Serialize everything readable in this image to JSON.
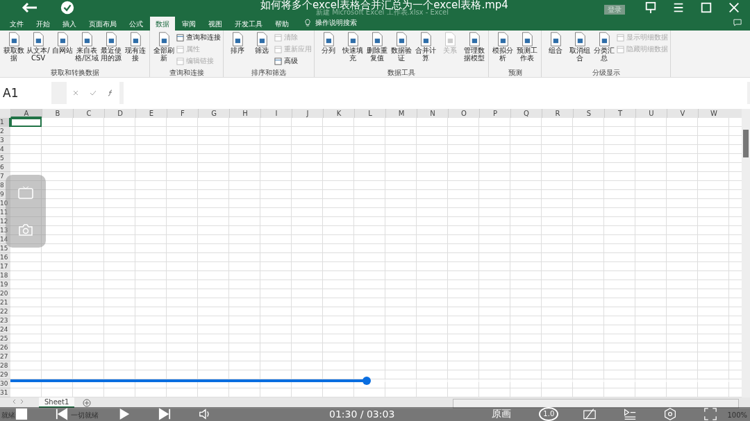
{
  "video": {
    "title": "如何将多个excel表格合并汇总为一个excel表格.mp4",
    "time": "01:30 / 03:03",
    "progress": {
      "level": 0.49
    },
    "quality": "原画",
    "speed": "1.0"
  },
  "excel": {
    "doc_title": "新建 Microsoft Excel 工作表.xlsx - Excel",
    "login": "登录",
    "tabs": [
      {
        "label": "文件",
        "selected": false
      },
      {
        "label": "开始",
        "selected": false
      },
      {
        "label": "插入",
        "selected": false
      },
      {
        "label": "页面布局",
        "selected": false
      },
      {
        "label": "公式",
        "selected": false
      },
      {
        "label": "数据",
        "selected": true
      },
      {
        "label": "审阅",
        "selected": false
      },
      {
        "label": "视图",
        "selected": false
      },
      {
        "label": "开发工具",
        "selected": false
      },
      {
        "label": "帮助",
        "selected": false
      }
    ],
    "tell_me": "操作说明搜索",
    "groups": [
      {
        "label": "获取和转换数据",
        "buttons": [
          {
            "label": "获取数据",
            "kind": "large",
            "disabled": false
          },
          {
            "label": "从文本/CSV",
            "kind": "large",
            "disabled": false
          },
          {
            "label": "自网站",
            "kind": "large",
            "disabled": false
          },
          {
            "label": "来自表格/区域",
            "kind": "large",
            "disabled": false
          },
          {
            "label": "最近使用的源",
            "kind": "large",
            "disabled": false
          },
          {
            "label": "现有连接",
            "kind": "large",
            "disabled": false
          }
        ]
      },
      {
        "label": "查询和连接",
        "buttons": [
          {
            "label": "全部刷新",
            "kind": "large",
            "disabled": false
          },
          {
            "label": "查询和连接",
            "kind": "small",
            "disabled": false
          },
          {
            "label": "属性",
            "kind": "small",
            "disabled": true
          },
          {
            "label": "编辑链接",
            "kind": "small",
            "disabled": true
          }
        ]
      },
      {
        "label": "排序和筛选",
        "buttons": [
          {
            "label": "排序",
            "kind": "large",
            "disabled": false
          },
          {
            "label": "筛选",
            "kind": "large",
            "disabled": false
          },
          {
            "label": "清除",
            "kind": "small",
            "disabled": true
          },
          {
            "label": "重新应用",
            "kind": "small",
            "disabled": true
          },
          {
            "label": "高级",
            "kind": "small",
            "disabled": false
          }
        ]
      },
      {
        "label": "数据工具",
        "buttons": [
          {
            "label": "分列",
            "kind": "large",
            "disabled": false
          },
          {
            "label": "快速填充",
            "kind": "large",
            "disabled": false
          },
          {
            "label": "删除重复值",
            "kind": "large",
            "disabled": false
          },
          {
            "label": "数据验证",
            "kind": "large",
            "disabled": false
          },
          {
            "label": "合并计算",
            "kind": "large",
            "disabled": false
          },
          {
            "label": "关系",
            "kind": "large",
            "disabled": true
          },
          {
            "label": "管理数据模型",
            "kind": "large",
            "disabled": false
          }
        ]
      },
      {
        "label": "预测",
        "buttons": [
          {
            "label": "模拟分析",
            "kind": "large",
            "disabled": false
          },
          {
            "label": "预测工作表",
            "kind": "large",
            "disabled": false
          }
        ]
      },
      {
        "label": "分级显示",
        "buttons": [
          {
            "label": "组合",
            "kind": "large",
            "disabled": false
          },
          {
            "label": "取消组合",
            "kind": "large",
            "disabled": false
          },
          {
            "label": "分类汇总",
            "kind": "large",
            "disabled": false
          },
          {
            "label": "显示明细数据",
            "kind": "small",
            "disabled": true
          },
          {
            "label": "隐藏明细数据",
            "kind": "small",
            "disabled": true
          }
        ]
      }
    ],
    "name_box": "A1",
    "columns": [
      {
        "label": "A",
        "selected": true
      },
      {
        "label": "B",
        "selected": false
      },
      {
        "label": "C",
        "selected": false
      },
      {
        "label": "D",
        "selected": false
      },
      {
        "label": "E",
        "selected": false
      },
      {
        "label": "F",
        "selected": false
      },
      {
        "label": "G",
        "selected": false
      },
      {
        "label": "H",
        "selected": false
      },
      {
        "label": "I",
        "selected": false
      },
      {
        "label": "J",
        "selected": false
      },
      {
        "label": "K",
        "selected": false
      },
      {
        "label": "L",
        "selected": false
      },
      {
        "label": "M",
        "selected": false
      },
      {
        "label": "N",
        "selected": false
      },
      {
        "label": "O",
        "selected": false
      },
      {
        "label": "P",
        "selected": false
      },
      {
        "label": "Q",
        "selected": false
      },
      {
        "label": "R",
        "selected": false
      },
      {
        "label": "S",
        "selected": false
      },
      {
        "label": "T",
        "selected": false
      },
      {
        "label": "U",
        "selected": false
      },
      {
        "label": "V",
        "selected": false
      },
      {
        "label": "W",
        "selected": false
      }
    ],
    "rows": [
      {
        "label": "1",
        "selected": true
      },
      {
        "label": "2",
        "selected": false
      },
      {
        "label": "3",
        "selected": false
      },
      {
        "label": "4",
        "selected": false
      },
      {
        "label": "5",
        "selected": false
      },
      {
        "label": "6",
        "selected": false
      },
      {
        "label": "7",
        "selected": false
      },
      {
        "label": "8",
        "selected": false
      },
      {
        "label": "9",
        "selected": false
      },
      {
        "label": "10",
        "selected": false
      },
      {
        "label": "11",
        "selected": false
      },
      {
        "label": "12",
        "selected": false
      },
      {
        "label": "13",
        "selected": false
      },
      {
        "label": "14",
        "selected": false
      },
      {
        "label": "15",
        "selected": false
      },
      {
        "label": "16",
        "selected": false
      },
      {
        "label": "17",
        "selected": false
      },
      {
        "label": "18",
        "selected": false
      },
      {
        "label": "19",
        "selected": false
      },
      {
        "label": "20",
        "selected": false
      },
      {
        "label": "21",
        "selected": false
      },
      {
        "label": "22",
        "selected": false
      },
      {
        "label": "23",
        "selected": false
      },
      {
        "label": "24",
        "selected": false
      },
      {
        "label": "25",
        "selected": false
      },
      {
        "label": "26",
        "selected": false
      },
      {
        "label": "27",
        "selected": false
      },
      {
        "label": "28",
        "selected": false
      },
      {
        "label": "29",
        "selected": false
      },
      {
        "label": "30",
        "selected": false
      },
      {
        "label": "31",
        "selected": false
      }
    ],
    "sheets": [
      {
        "label": "Sheet1",
        "selected": true
      }
    ],
    "status": [
      "就绪",
      "一切就绪"
    ],
    "zoom": "100%"
  }
}
